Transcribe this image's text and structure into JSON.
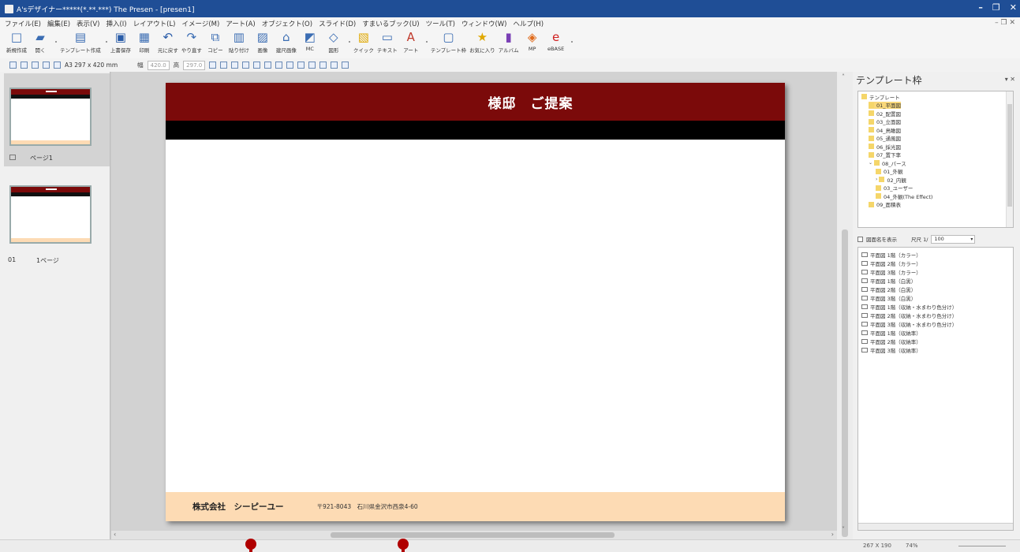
{
  "window": {
    "title": "A'sデザイナー*****(*.**.***) The Presen - [presen1]"
  },
  "menu": {
    "items": [
      "ファイル(E)",
      "編集(E)",
      "表示(V)",
      "挿入(I)",
      "レイアウト(L)",
      "イメージ(M)",
      "アート(A)",
      "オブジェクト(O)",
      "スライド(D)",
      "すまいるブック(U)",
      "ツール(T)",
      "ウィンドウ(W)",
      "ヘルプ(H)"
    ]
  },
  "ribbon": {
    "buttons": [
      {
        "label": "新規作成",
        "icon": "new-file-icon"
      },
      {
        "label": "開く",
        "icon": "open-folder-icon"
      },
      {
        "label": "テンプレート作成",
        "icon": "template-create-icon"
      },
      {
        "label": "上書保存",
        "icon": "save-icon"
      },
      {
        "label": "印刷",
        "icon": "print-icon"
      },
      {
        "label": "元に戻す",
        "icon": "undo-icon"
      },
      {
        "label": "やり直す",
        "icon": "redo-icon"
      },
      {
        "label": "コピー",
        "icon": "copy-icon"
      },
      {
        "label": "貼り付け",
        "icon": "paste-icon"
      },
      {
        "label": "画像",
        "icon": "image-icon"
      },
      {
        "label": "建尺画像",
        "icon": "building-image-icon"
      },
      {
        "label": "MC",
        "icon": "mc-icon"
      },
      {
        "label": "図形",
        "icon": "shape-icon"
      },
      {
        "label": "クイック",
        "icon": "quick-icon"
      },
      {
        "label": "テキスト",
        "icon": "text-icon"
      },
      {
        "label": "アート",
        "icon": "art-icon"
      },
      {
        "label": "テンプレート枠",
        "icon": "template-frame-icon"
      },
      {
        "label": "お気に入り",
        "icon": "favorites-icon"
      },
      {
        "label": "アルバム",
        "icon": "album-icon"
      },
      {
        "label": "MP",
        "icon": "mp-icon"
      },
      {
        "label": "eBASE",
        "icon": "ebase-icon"
      }
    ]
  },
  "toolbar2": {
    "paper_size": "A3 297 x 420 mm",
    "width_label": "幅",
    "width_value": "420.0",
    "height_label": "高",
    "height_value": "297.0"
  },
  "pages": [
    {
      "label": "ページ1",
      "number": ""
    },
    {
      "label": "1ページ",
      "number": "01"
    }
  ],
  "slide": {
    "title": "様邸　ご提案",
    "company": "株式会社　シーピーユー",
    "address": "〒921-8043　石川県金沢市西泉4-60"
  },
  "right_panel": {
    "title": "テンプレート枠",
    "tree": [
      {
        "label": "テンプレート",
        "indent": 0,
        "selected": false,
        "arrow": ""
      },
      {
        "label": "01_平面図",
        "indent": 1,
        "selected": true,
        "arrow": ""
      },
      {
        "label": "02_配置図",
        "indent": 1,
        "selected": false,
        "arrow": ""
      },
      {
        "label": "03_立面図",
        "indent": 1,
        "selected": false,
        "arrow": ""
      },
      {
        "label": "04_鳥瞰図",
        "indent": 1,
        "selected": false,
        "arrow": ""
      },
      {
        "label": "05_通風図",
        "indent": 1,
        "selected": false,
        "arrow": ""
      },
      {
        "label": "06_採光図",
        "indent": 1,
        "selected": false,
        "arrow": ""
      },
      {
        "label": "07_置下率",
        "indent": 1,
        "selected": false,
        "arrow": ""
      },
      {
        "label": "08_パース",
        "indent": 1,
        "selected": false,
        "arrow": "⌄"
      },
      {
        "label": "01_外観",
        "indent": 2,
        "selected": false,
        "arrow": ""
      },
      {
        "label": "02_内観",
        "indent": 2,
        "selected": false,
        "arrow": "›"
      },
      {
        "label": "03_ユーザー",
        "indent": 2,
        "selected": false,
        "arrow": ""
      },
      {
        "label": "04_外観(The Effect)",
        "indent": 2,
        "selected": false,
        "arrow": ""
      },
      {
        "label": "09_面積表",
        "indent": 1,
        "selected": false,
        "arrow": ""
      }
    ],
    "show_names_label": "図面名を表示",
    "scale_label": "尺尺 1/",
    "scale_value": "100",
    "list": [
      "平面図 1階（カラー）",
      "平面図 2階（カラー）",
      "平面図 3階（カラー）",
      "平面図 1階（白黒）",
      "平面図 2階（白黒）",
      "平面図 3階（白黒）",
      "平面図 1階（収納・水まわり色分け）",
      "平面図 2階（収納・水まわり色分け）",
      "平面図 3階（収納・水まわり色分け）",
      "平面図 1階（収納率）",
      "平面図 2階（収納率）",
      "平面図 3階（収納率）"
    ]
  },
  "status": {
    "coords": "267 X 190",
    "zoom": "74%"
  },
  "colors": {
    "titlebar": "#1f4e96",
    "slide_header": "#7b0a0a",
    "slide_footer": "#fddbb4",
    "marker": "#b00000"
  }
}
